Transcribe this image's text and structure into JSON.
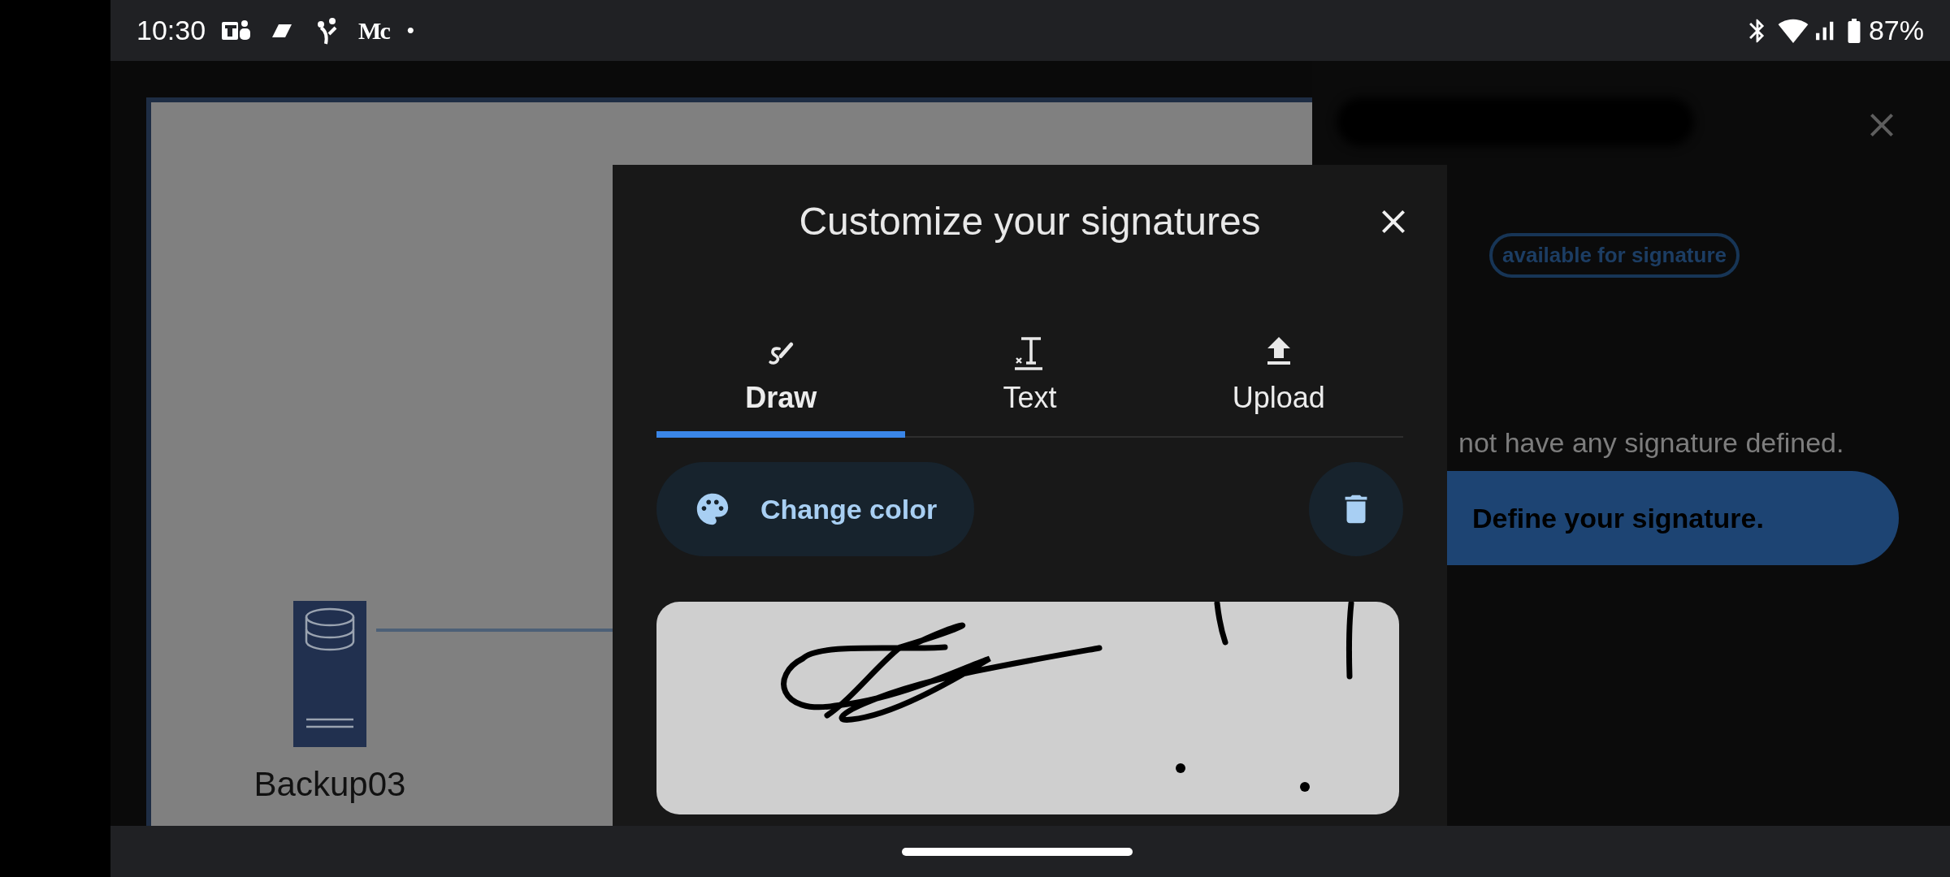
{
  "status_bar": {
    "time": "10:30",
    "notification_text": "Mc",
    "dot": "•",
    "battery": "87%"
  },
  "diagram": {
    "nodes": [
      {
        "label": "Backup03"
      }
    ]
  },
  "side_panel": {
    "badge": "available for signature",
    "message": "not have any signature defined.",
    "button": "Define your signature."
  },
  "dialog": {
    "title": "Customize your signatures",
    "tabs": [
      {
        "label": "Draw",
        "kind": "draw",
        "selected": true
      },
      {
        "label": "Text",
        "kind": "text",
        "selected": false
      },
      {
        "label": "Upload",
        "kind": "upload",
        "selected": false
      }
    ],
    "change_color": "Change color"
  }
}
